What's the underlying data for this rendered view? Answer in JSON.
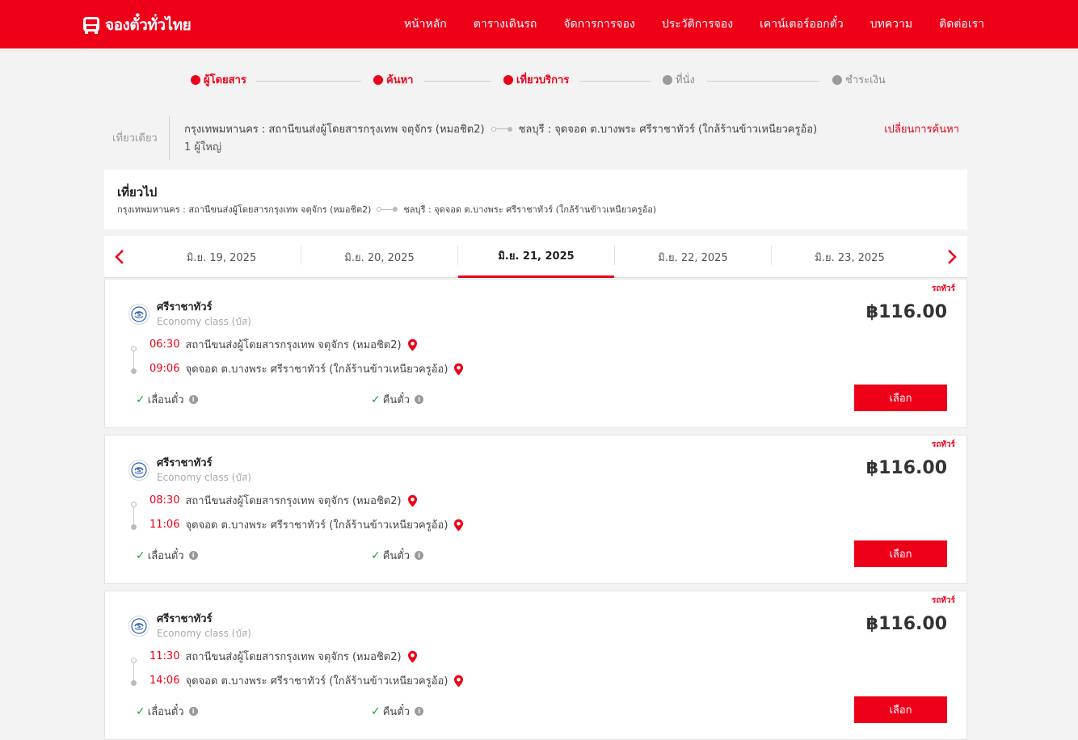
{
  "header": {
    "logo_text": "จองตั๋วทั่วไทย",
    "nav": [
      "หน้าหลัก",
      "ตารางเดินรถ",
      "จัดการการจอง",
      "ประวัติการจอง",
      "เคาน์เตอร์ออกตั๋ว",
      "บทความ",
      "ติดต่อเรา"
    ]
  },
  "steps": [
    {
      "label": "ผู้โดยสาร",
      "state": "active"
    },
    {
      "label": "ค้นหา",
      "state": "active"
    },
    {
      "label": "เที่ยวบริการ",
      "state": "active"
    },
    {
      "label": "ที่นั่ง",
      "state": "inactive"
    },
    {
      "label": "ชำระเงิน",
      "state": "inactive"
    }
  ],
  "summary": {
    "trip_type": "เที่ยวเดียว",
    "origin": "กรุงเทพมหานคร : สถานีขนส่งผู้โดยสารกรุงเทพ จตุจักร (หมอชิต2)",
    "destination": "ชลบุรี : จุดจอด ต.บางพระ ศรีราชาทัวร์ (ใกล้ร้านข้าวเหนียวครูอ้อ)",
    "passengers": "1 ผู้ใหญ่",
    "change_search": "เปลี่ยนการค้นหา"
  },
  "outbound": {
    "title": "เที่ยวไป",
    "origin": "กรุงเทพมหานคร : สถานีขนส่งผู้โดยสารกรุงเทพ จตุจักร (หมอชิต2)",
    "destination": "ชลบุรี : จุดจอด ต.บางพระ ศรีราชาทัวร์ (ใกล้ร้านข้าวเหนียวครูอ้อ)"
  },
  "dates": [
    {
      "label": "มิ.ย. 19, 2025",
      "active": false
    },
    {
      "label": "มิ.ย. 20, 2025",
      "active": false
    },
    {
      "label": "มิ.ย. 21, 2025",
      "active": true
    },
    {
      "label": "มิ.ย. 22, 2025",
      "active": false
    },
    {
      "label": "มิ.ย. 23, 2025",
      "active": false
    }
  ],
  "trips": [
    {
      "tag": "รถทัวร์",
      "operator": "ศรีราชาทัวร์",
      "class": "Economy class (บัส)",
      "price": "฿116.00",
      "dep_time": "06:30",
      "dep_place": "สถานีขนส่งผู้โดยสารกรุงเทพ จตุจักร (หมอชิต2)",
      "arr_time": "09:06",
      "arr_place": "จุดจอด ต.บางพระ ศรีราชาทัวร์ (ใกล้ร้านข้าวเหนียวครูอ้อ)",
      "reschedule": "เลื่อนตั๋ว",
      "refund": "คืนตั๋ว",
      "select": "เลือก"
    },
    {
      "tag": "รถทัวร์",
      "operator": "ศรีราชาทัวร์",
      "class": "Economy class (บัส)",
      "price": "฿116.00",
      "dep_time": "08:30",
      "dep_place": "สถานีขนส่งผู้โดยสารกรุงเทพ จตุจักร (หมอชิต2)",
      "arr_time": "11:06",
      "arr_place": "จุดจอด ต.บางพระ ศรีราชาทัวร์ (ใกล้ร้านข้าวเหนียวครูอ้อ)",
      "reschedule": "เลื่อนตั๋ว",
      "refund": "คืนตั๋ว",
      "select": "เลือก"
    },
    {
      "tag": "รถทัวร์",
      "operator": "ศรีราชาทัวร์",
      "class": "Economy class (บัส)",
      "price": "฿116.00",
      "dep_time": "11:30",
      "dep_place": "สถานีขนส่งผู้โดยสารกรุงเทพ จตุจักร (หมอชิต2)",
      "arr_time": "14:06",
      "arr_place": "จุดจอด ต.บางพระ ศรีราชาทัวร์ (ใกล้ร้านข้าวเหนียวครูอ้อ)",
      "reschedule": "เลื่อนตั๋ว",
      "refund": "คืนตั๋ว",
      "select": "เลือก"
    }
  ],
  "colors": {
    "brand": "#ee0018",
    "check": "#1aa33c"
  },
  "icons": {
    "arrow_left": "chevron-left-icon",
    "arrow_right": "chevron-right-icon",
    "pin": "map-pin-icon",
    "info": "info-icon",
    "check": "check-icon"
  }
}
